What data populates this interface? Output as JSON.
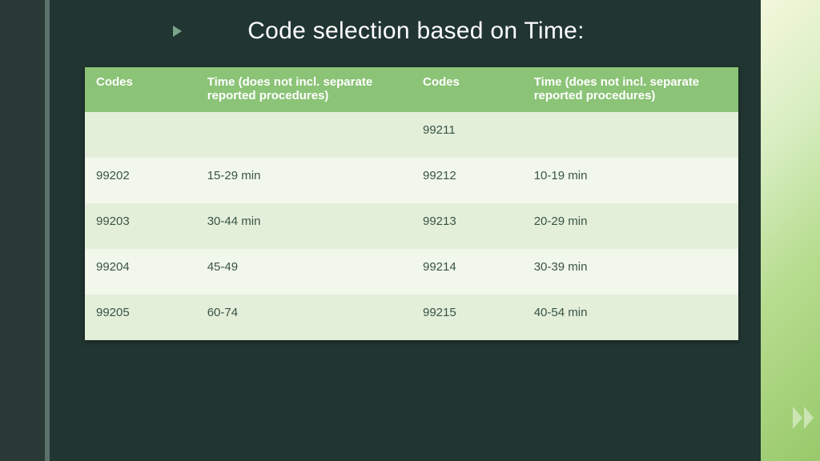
{
  "title": "Code selection based on Time:",
  "headers": {
    "codes_a": "Codes",
    "time_a": "Time (does not incl. separate reported procedures)",
    "codes_b": "Codes",
    "time_b": "Time (does not incl. separate reported procedures)"
  },
  "rows": [
    {
      "code_a": "",
      "time_a": "",
      "code_b": "99211",
      "time_b": ""
    },
    {
      "code_a": "99202",
      "time_a": "15-29 min",
      "code_b": "99212",
      "time_b": "10-19 min"
    },
    {
      "code_a": "99203",
      "time_a": "30-44 min",
      "code_b": "99213",
      "time_b": "20-29 min"
    },
    {
      "code_a": "99204",
      "time_a": "45-49",
      "code_b": "99214",
      "time_b": "30-39 min"
    },
    {
      "code_a": "99205",
      "time_a": "60-74",
      "code_b": "99215",
      "time_b": "40-54 min"
    }
  ]
}
